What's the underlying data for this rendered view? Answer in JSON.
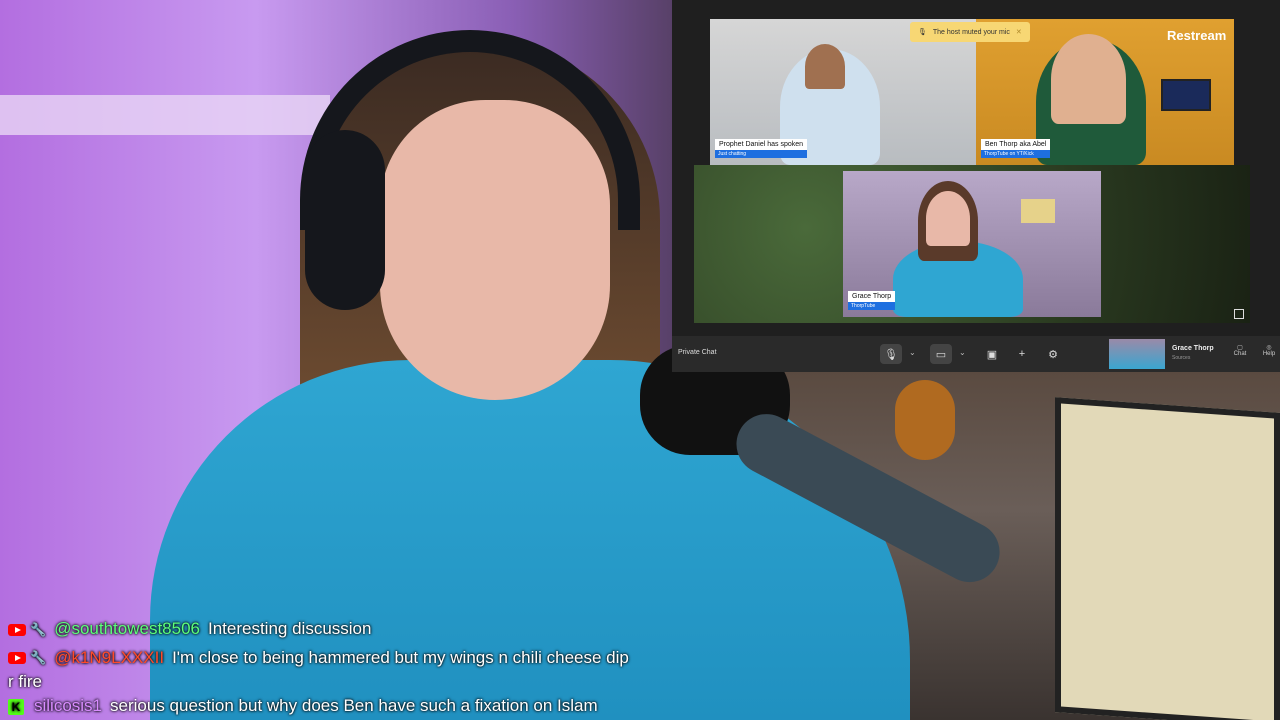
{
  "meeting": {
    "muted_toast": "The host muted your mic",
    "brand": "Restream",
    "participants": [
      {
        "name": "Prophet Daniel has spoken",
        "sub": "Just chatting"
      },
      {
        "name": "Ben Thorp aka Abel",
        "sub": "ThorpTube on YT/Kick"
      },
      {
        "name": "Grace Thorp",
        "sub": "ThorpTube"
      }
    ],
    "toolbar": {
      "private_chat": "Private Chat",
      "host_name": "Grace Thorp",
      "host_sub": "Sources",
      "chat_label": "Chat",
      "help_label": "Help"
    }
  },
  "chat": {
    "messages": [
      {
        "platform": "youtube",
        "user": "@southtowest8506",
        "user_color": "#5cff7a",
        "text": "Interesting discussion",
        "continuation": ""
      },
      {
        "platform": "youtube",
        "user": "@k1N9LXXXII",
        "user_color": "#ff4a2a",
        "text": "I'm close to being hammered but my wings n chili cheese dip",
        "continuation": "r fire"
      },
      {
        "platform": "kick",
        "user": "silicosis1",
        "user_color": "#d98cff",
        "text": "serious question but why does Ben have such a fixation on Islam",
        "continuation": ""
      }
    ]
  },
  "colors": {
    "youtube": "#ff0000",
    "kick": "#53fc18",
    "zoom_blue": "#1e6fe0",
    "toast_yellow": "#f7d774"
  },
  "icons": [
    "youtube-icon",
    "wrench-icon",
    "kick-icon",
    "mic-icon",
    "camera-icon",
    "share-screen-icon",
    "plus-icon",
    "gear-icon",
    "expand-icon",
    "chat-icon",
    "help-icon",
    "mic-muted-icon",
    "close-icon"
  ]
}
